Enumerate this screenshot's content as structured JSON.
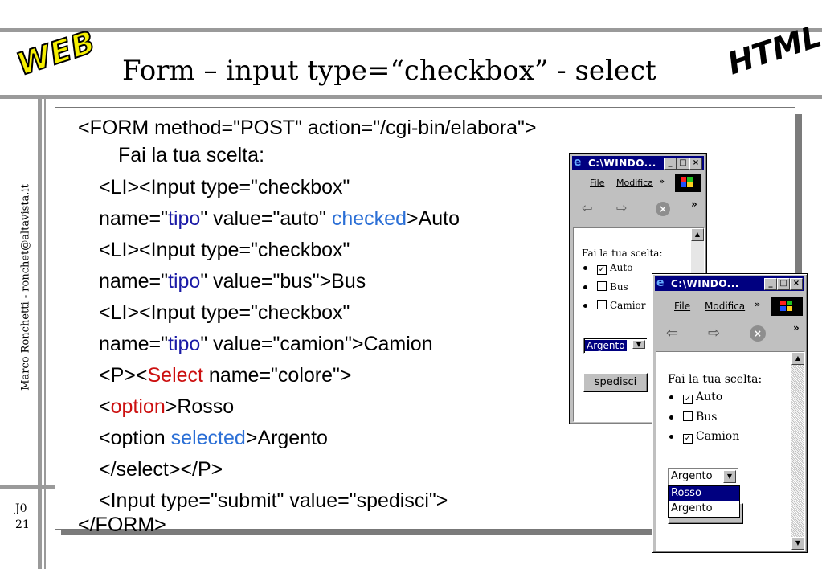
{
  "header": {
    "title": "Form – input type=“checkbox” - select",
    "logo_left": "WEB",
    "logo_right": "HTML"
  },
  "sidebar": {
    "author": "Marco Ronchetti  -  ronchet@altavista.it",
    "slide_code": "J0",
    "slide_number": "21"
  },
  "code": {
    "l1": "<FORM method=\"POST\" action=\"/cgi-bin/elabora\">",
    "l2": "Fai la tua scelta:",
    "l3": "<LI><Input type=\"checkbox\"",
    "l4a": "name=\"",
    "l4b": "tipo",
    "l4c": "\" value=\"auto\" ",
    "l4d": "checked",
    "l4e": ">Auto",
    "l5": "<LI><Input type=\"checkbox\"",
    "l6a": "name=\"",
    "l6b": "tipo",
    "l6c": "\" value=\"bus\">Bus",
    "l7": "<LI><Input type=\"checkbox\"",
    "l8a": "name=\"",
    "l8b": "tipo",
    "l8c": "\" value=\"camion\">Camion",
    "l9a": "<P><",
    "l9b": "Select",
    "l9c": " name=\"colore\">",
    "l10a": "<",
    "l10b": "option",
    "l10c": ">Rosso",
    "l11a": "<option ",
    "l11b": "selected",
    "l11c": ">Argento",
    "l12": "</select></P>",
    "l13": "<Input type=\"submit\" value=\"spedisci\">",
    "l14": "</FORM>"
  },
  "browser1": {
    "window_title": "C:\\WINDO...",
    "menu_file": "File",
    "menu_modifica": "Modifica",
    "chevron": "»",
    "prompt": "Fai la tua scelta:",
    "options": [
      {
        "label": "Auto",
        "checked": true
      },
      {
        "label": "Bus",
        "checked": false
      },
      {
        "label": "Camior",
        "checked": false
      }
    ],
    "select_value": "Argento",
    "submit_label": "spedisci"
  },
  "browser2": {
    "window_title": "C:\\WINDO...",
    "menu_file": "File",
    "menu_modifica": "Modifica",
    "chevron": "»",
    "prompt": "Fai la tua scelta:",
    "options": [
      {
        "label": "Auto",
        "checked": true
      },
      {
        "label": "Bus",
        "checked": false
      },
      {
        "label": "Camion",
        "checked": true
      }
    ],
    "select_value": "Argento",
    "dropdown_options": [
      "Rosso",
      "Argento"
    ],
    "submit_partial": "spedisci"
  },
  "icons": {
    "window_control_minimize": "_",
    "window_control_maximize": "□",
    "window_control_close": "×",
    "back_arrow": "⇦",
    "forward_arrow": "⇨",
    "stop": "×",
    "check": "✓",
    "scroll_up": "▲",
    "scroll_down": "▼",
    "select_arrow": "▼"
  },
  "colors": {
    "keyword_blue": "#1a1aa6",
    "keyword_light_blue": "#2b6fd6",
    "keyword_red": "#cc1010",
    "titlebar": "#000080",
    "selection": "#000080"
  }
}
